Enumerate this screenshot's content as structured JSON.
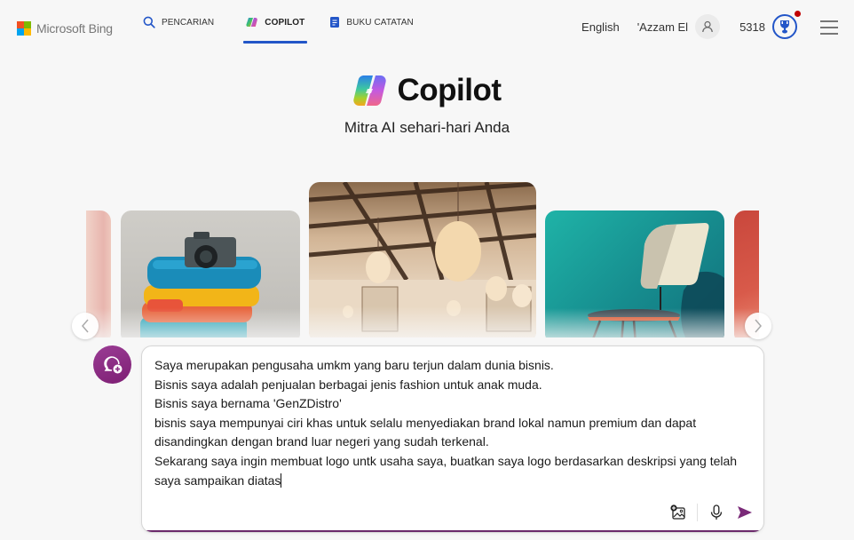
{
  "header": {
    "brand": "Microsoft Bing",
    "nav": [
      {
        "label": "PENCARIAN",
        "icon": "search-icon",
        "active": false
      },
      {
        "label": "COPILOT",
        "icon": "copilot-icon",
        "active": true
      },
      {
        "label": "BUKU CATATAN",
        "icon": "notebook-icon",
        "active": false
      }
    ],
    "language": "English",
    "user_name": "'Azzam El",
    "points": "5318"
  },
  "hero": {
    "title": "Copilot",
    "subtitle": "Mitra AI sehari-hari Anda"
  },
  "carousel": {
    "cards": [
      {
        "name": "partial-pink-card"
      },
      {
        "name": "clothes-camera-card"
      },
      {
        "name": "lantern-ceiling-card"
      },
      {
        "name": "chair-teal-card"
      },
      {
        "name": "partial-red-card"
      }
    ],
    "prev_icon": "chevron-left-icon",
    "next_icon": "chevron-right-icon"
  },
  "composer": {
    "text": "Saya merupakan pengusaha umkm yang baru terjun dalam dunia bisnis.\nBisnis saya adalah penjualan berbagai jenis fashion untuk anak muda.\nBisnis saya bernama 'GenZDistro'\nbisnis saya mempunyai ciri khas untuk selalu menyediakan brand lokal namun premium dan dapat disandingkan dengan brand luar negeri yang sudah terkenal.\nSekarang saya ingin membuat logo untk usaha saya, buatkan saya logo berdasarkan deskripsi yang telah saya sampaikan diatas"
  },
  "colors": {
    "accent_blue": "#2356c8",
    "new_topic_purple": "#8a2a82",
    "send_purple": "#7a2a78",
    "notification_red": "#c00000"
  }
}
